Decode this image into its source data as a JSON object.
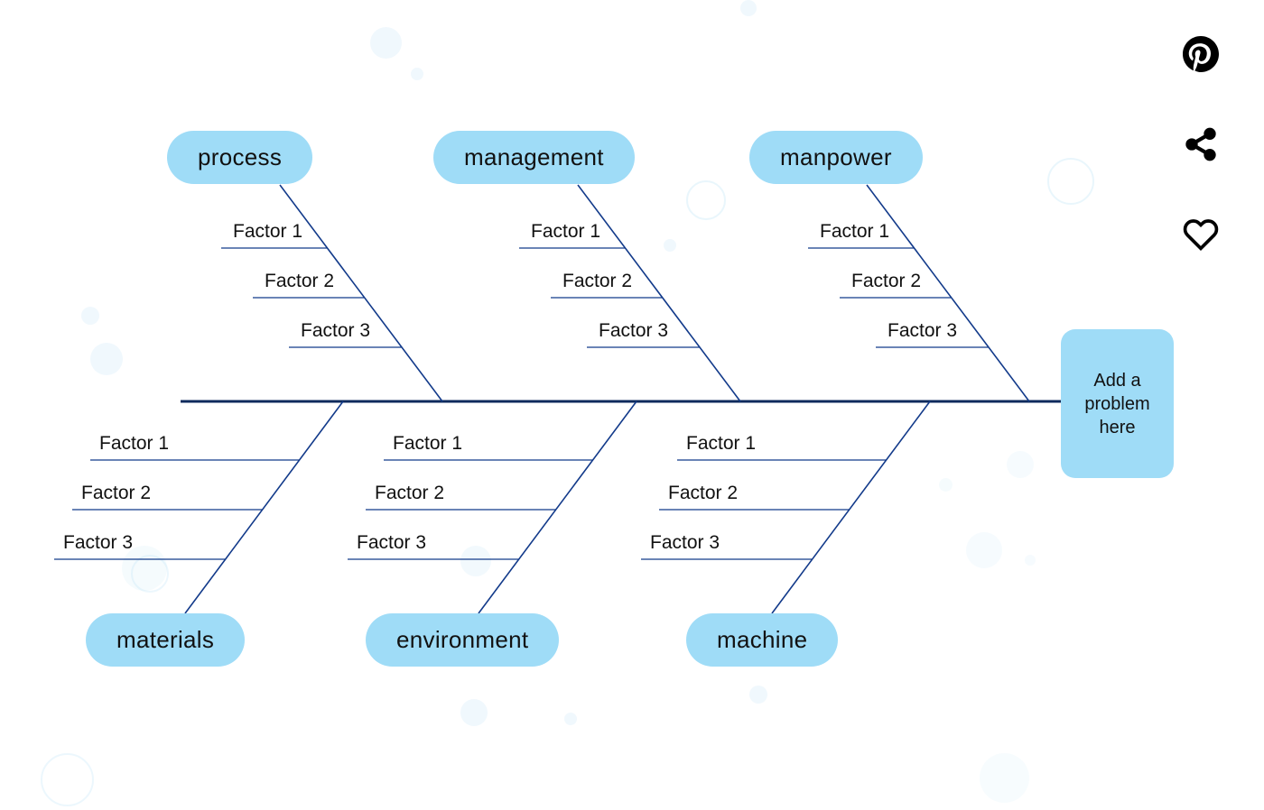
{
  "diagram": {
    "type": "fishbone",
    "head_label": "Add a problem here",
    "categories_top": [
      {
        "label": "process",
        "factors": [
          "Factor 1",
          "Factor 2",
          "Factor 3"
        ]
      },
      {
        "label": "management",
        "factors": [
          "Factor 1",
          "Factor 2",
          "Factor 3"
        ]
      },
      {
        "label": "manpower",
        "factors": [
          "Factor 1",
          "Factor 2",
          "Factor 3"
        ]
      }
    ],
    "categories_bottom": [
      {
        "label": "materials",
        "factors": [
          "Factor 1",
          "Factor 2",
          "Factor 3"
        ]
      },
      {
        "label": "environment",
        "factors": [
          "Factor 1",
          "Factor 2",
          "Factor 3"
        ]
      },
      {
        "label": "machine",
        "factors": [
          "Factor 1",
          "Factor 2",
          "Factor 3"
        ]
      }
    ],
    "colors": {
      "pill_bg": "#9fdcf7",
      "line": "#123a8a",
      "spine": "#0c2a5c"
    }
  }
}
